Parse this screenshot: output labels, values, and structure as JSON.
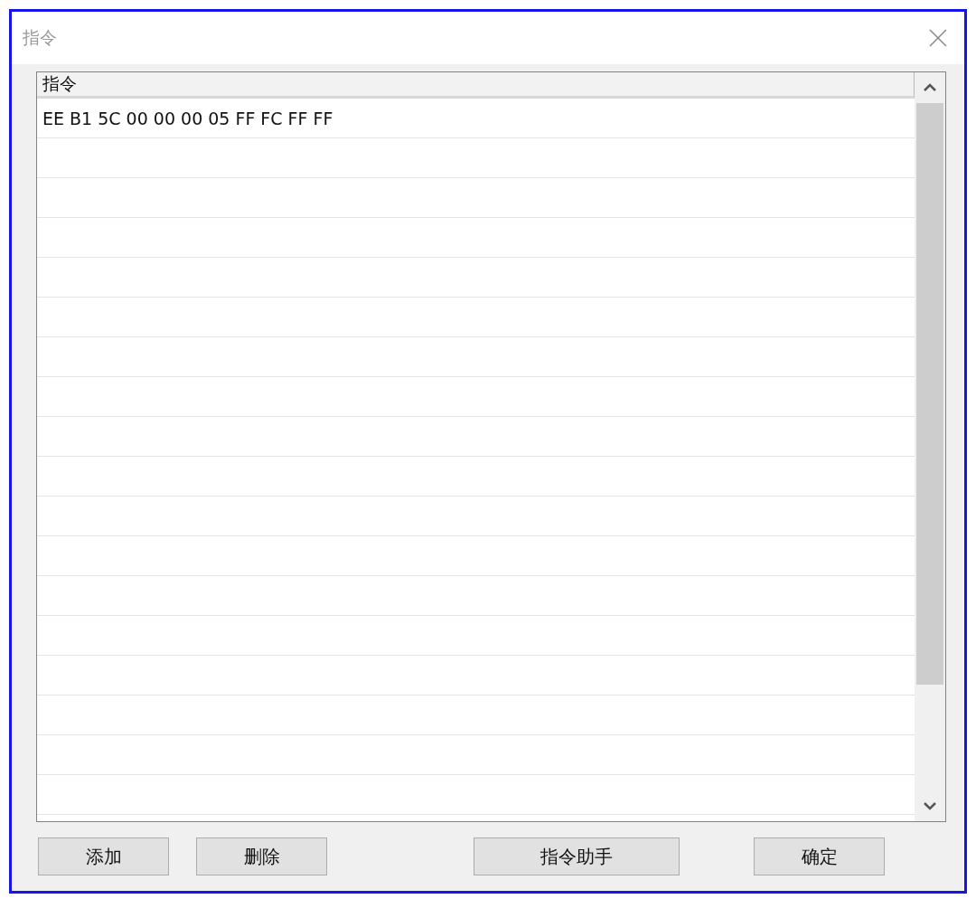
{
  "window": {
    "title": "指令"
  },
  "table": {
    "columns": [
      "指令"
    ],
    "rows": [
      [
        "EE B1 5C 00 00 00 05 FF FC FF FF"
      ]
    ]
  },
  "buttons": [
    {
      "label": "添加"
    },
    {
      "label": "删除"
    },
    {
      "label": "指令助手"
    },
    {
      "label": "确定"
    }
  ]
}
